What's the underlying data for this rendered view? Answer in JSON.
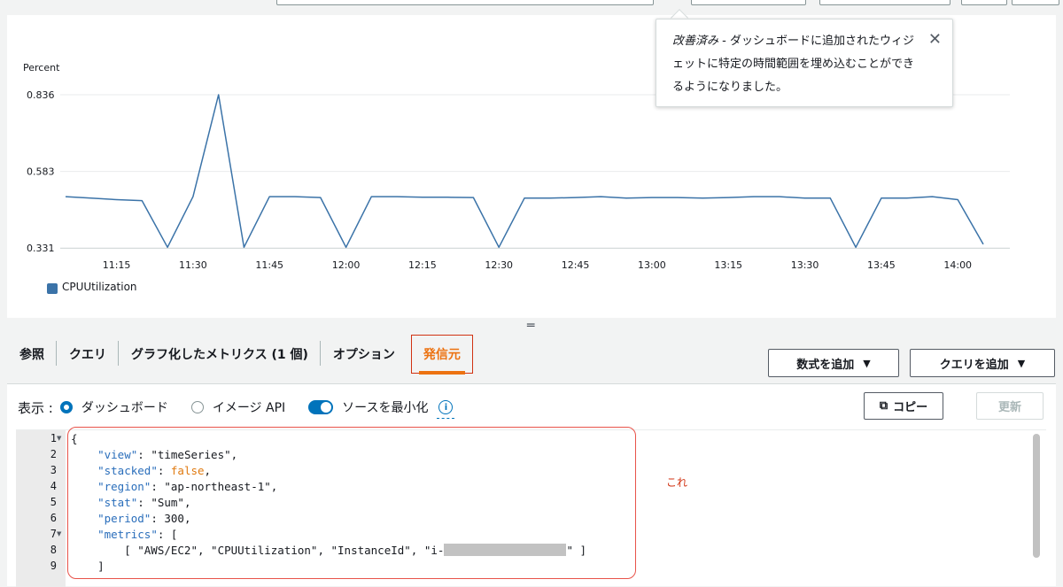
{
  "chart_data": {
    "type": "line",
    "ylabel": "Percent",
    "yticks": [
      "0.836",
      "0.583",
      "0.331"
    ],
    "ylim": [
      0.331,
      0.836
    ],
    "xticks": [
      "11:15",
      "11:30",
      "11:45",
      "12:00",
      "12:15",
      "12:30",
      "12:45",
      "13:00",
      "13:15",
      "13:30",
      "13:45",
      "14:00"
    ],
    "grid": true,
    "legend_position": "bottom-left",
    "series": [
      {
        "name": "CPUUtilization",
        "color": "#3b73a8",
        "x": [
          "11:05",
          "11:10",
          "11:15",
          "11:20",
          "11:25",
          "11:30",
          "11:35",
          "11:40",
          "11:45",
          "11:50",
          "11:55",
          "12:00",
          "12:05",
          "12:10",
          "12:15",
          "12:20",
          "12:25",
          "12:30",
          "12:35",
          "12:40",
          "12:45",
          "12:50",
          "12:55",
          "13:00",
          "13:05",
          "13:10",
          "13:15",
          "13:20",
          "13:25",
          "13:30",
          "13:35",
          "13:40",
          "13:45",
          "13:50",
          "13:55",
          "14:00",
          "14:05"
        ],
        "values": [
          0.5,
          0.495,
          0.49,
          0.487,
          0.333,
          0.5,
          0.836,
          0.333,
          0.5,
          0.5,
          0.497,
          0.333,
          0.5,
          0.5,
          0.498,
          0.498,
          0.497,
          0.333,
          0.495,
          0.495,
          0.497,
          0.5,
          0.495,
          0.497,
          0.497,
          0.495,
          0.497,
          0.5,
          0.5,
          0.495,
          0.495,
          0.333,
          0.495,
          0.495,
          0.5,
          0.49,
          0.343
        ]
      }
    ]
  },
  "popover": {
    "emphasis": "改善済み",
    "text": " - ダッシュボードに追加されたウィジェットに特定の時間範囲を埋め込むことができるようになりました。"
  },
  "tabs": [
    "参照",
    "クエリ",
    "グラフ化したメトリクス (1 個)",
    "オプション",
    "発信元"
  ],
  "active_tab": "発信元",
  "buttons": {
    "add_math": "数式を追加",
    "add_query": "クエリを追加",
    "copy": "コピー",
    "refresh": "更新"
  },
  "display": {
    "label": "表示 :",
    "options": [
      "ダッシュボード",
      "イメージ API"
    ],
    "selected": "ダッシュボード",
    "toggle_label": "ソースを最小化",
    "toggle_on": true
  },
  "editor": {
    "line_numbers": [
      "1",
      "2",
      "3",
      "4",
      "5",
      "6",
      "7",
      "8",
      "9"
    ],
    "lines": [
      "{",
      "    \"view\": \"timeSeries\",",
      "    \"stacked\": false,",
      "    \"region\": \"ap-northeast-1\",",
      "    \"stat\": \"Sum\",",
      "    \"period\": 300,",
      "    \"metrics\": [",
      "        [ \"AWS/EC2\", \"CPUUtilization\", \"InstanceId\", \"i-",
      "    ]"
    ],
    "masked_suffix": "\" ]"
  },
  "annotation": "これ"
}
